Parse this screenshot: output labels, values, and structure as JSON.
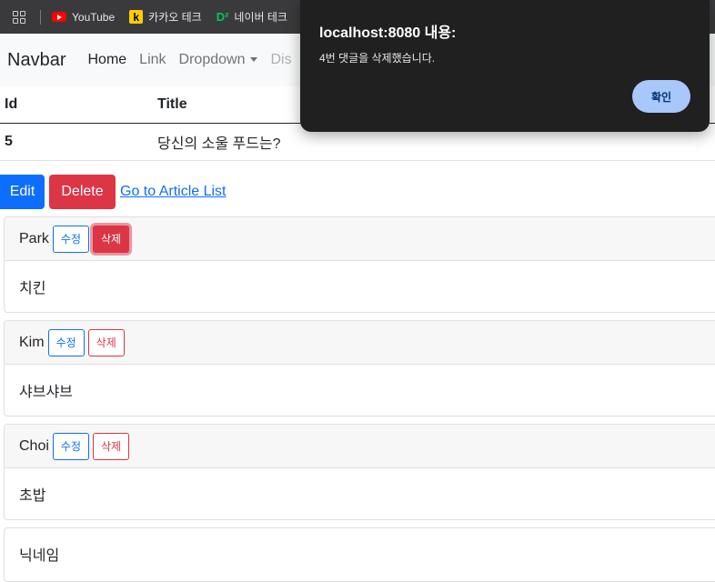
{
  "bookmarks": [
    {
      "label": "YouTube",
      "icon": "youtube-icon"
    },
    {
      "label": "카카오 테크",
      "icon": "kakao-icon"
    },
    {
      "label": "네이버 테크",
      "icon": "d2-icon"
    }
  ],
  "navbar": {
    "brand": "Navbar",
    "links": [
      "Home",
      "Link",
      "Dropdown",
      "Dis"
    ]
  },
  "table": {
    "headers": [
      "Id",
      "Title"
    ],
    "row": {
      "id": "5",
      "title": "당신의 소울 푸드는?"
    }
  },
  "actions": {
    "edit": "Edit",
    "delete": "Delete",
    "list_link": "Go to Article List"
  },
  "comments": [
    {
      "nickname": "Park",
      "body": "치킨",
      "edit": "수정",
      "delete": "삭제"
    },
    {
      "nickname": "Kim",
      "body": "샤브샤브",
      "edit": "수정",
      "delete": "삭제"
    },
    {
      "nickname": "Choi",
      "body": "초밥",
      "edit": "수정",
      "delete": "삭제"
    },
    {
      "nickname": "닉네임"
    }
  ],
  "dialog": {
    "title": "localhost:8080 내용:",
    "message": "4번 댓글을 삭제했습니다.",
    "ok": "확인"
  },
  "colors": {
    "primary": "#0d6efd",
    "danger": "#dc3545",
    "dialog_bg": "#202020",
    "dialog_button": "#a8c7fa"
  }
}
